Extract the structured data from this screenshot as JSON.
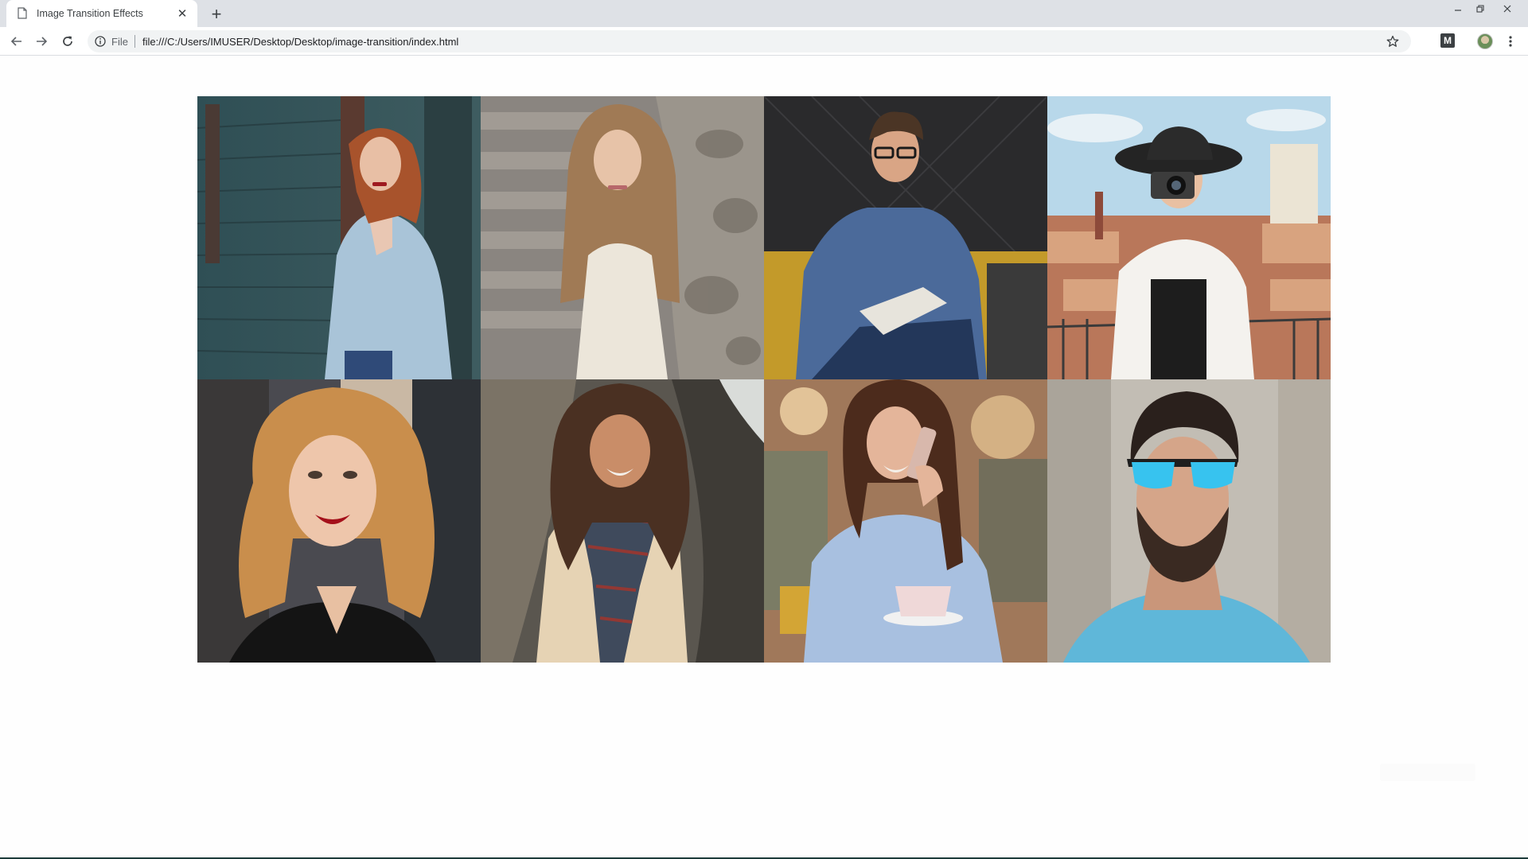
{
  "browser": {
    "tab_title": "Image Transition Effects",
    "tab_close_glyph": "✕",
    "new_tab_glyph": "+",
    "scheme_label": "File",
    "url": "file:///C:/Users/IMUSER/Desktop/Desktop/image-transition/index.html",
    "extension_label": "M"
  },
  "gallery": {
    "photos": [
      {
        "name": "woman-denim-jacket",
        "desc": "red-haired woman in light denim jacket against teal wooden wall"
      },
      {
        "name": "woman-white-dress",
        "desc": "long-haired woman in white top sitting by stone steps"
      },
      {
        "name": "man-glasses-notebook",
        "desc": "man with glasses in blue shirt writing on a yellow sofa"
      },
      {
        "name": "woman-hat-camera",
        "desc": "woman in black hat holding camera over rooftop view"
      },
      {
        "name": "woman-curly-hair",
        "desc": "woman with curly golden hair and red lipstick"
      },
      {
        "name": "woman-plaid-scarf",
        "desc": "smiling woman in plaid scarf against tree trunk"
      },
      {
        "name": "woman-phone-coffee",
        "desc": "woman on phone with coffee cup in cafe"
      },
      {
        "name": "man-blue-sunglasses",
        "desc": "bearded man in blue sunglasses looking up"
      }
    ]
  },
  "colors": {
    "tabstrip": "#dee1e6",
    "omnibox": "#f1f3f4",
    "page": "#fefefe"
  }
}
